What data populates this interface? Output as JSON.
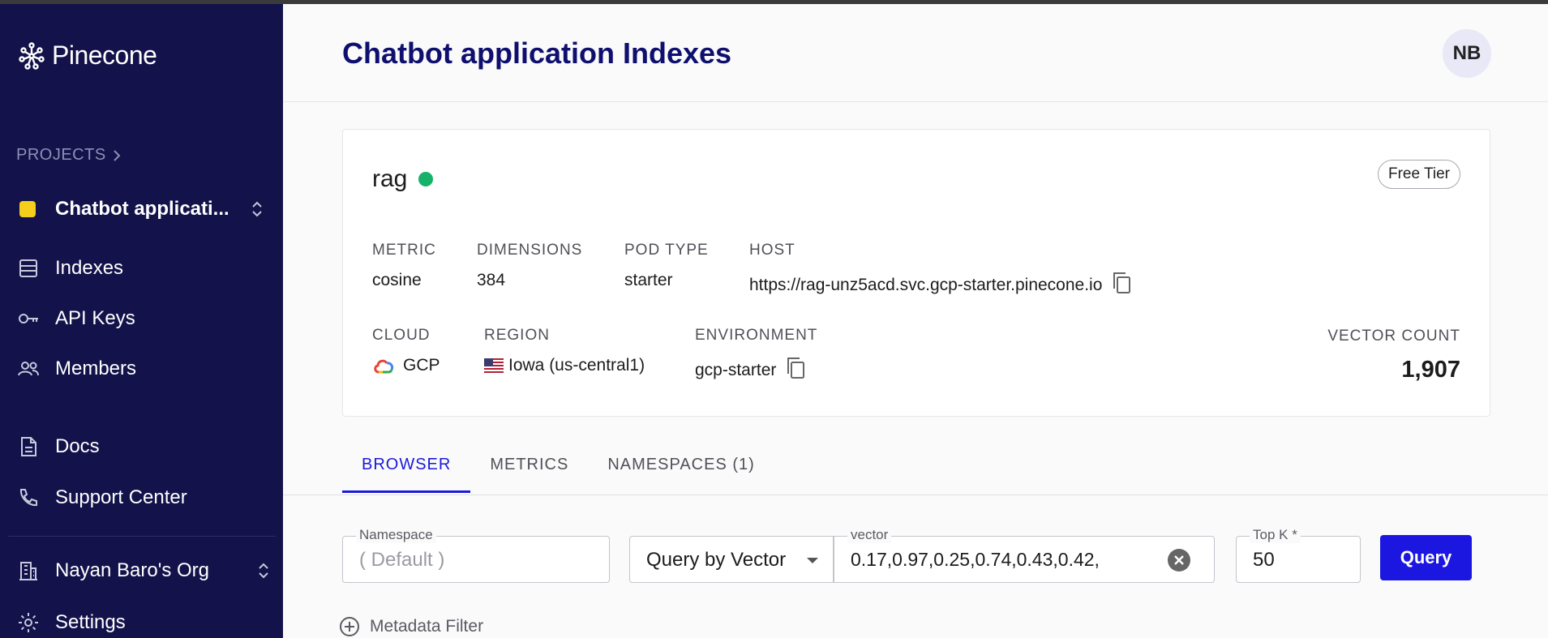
{
  "sidebar": {
    "logo_text": "Pinecone",
    "projects_label": "PROJECTS",
    "project_name": "Chatbot applicati...",
    "project_color": "#f5cf1b",
    "nav": {
      "indexes": "Indexes",
      "api_keys": "API Keys",
      "members": "Members",
      "docs": "Docs",
      "support": "Support Center",
      "org": "Nayan Baro's Org",
      "settings": "Settings"
    }
  },
  "header": {
    "title": "Chatbot application Indexes",
    "avatar_initials": "NB"
  },
  "index": {
    "name": "rag",
    "status_color": "#17b26a",
    "tier": "Free Tier",
    "metric_label": "METRIC",
    "metric": "cosine",
    "dimensions_label": "DIMENSIONS",
    "dimensions": "384",
    "pod_type_label": "POD TYPE",
    "pod_type": "starter",
    "host_label": "HOST",
    "host": "https://rag-unz5acd.svc.gcp-starter.pinecone.io",
    "cloud_label": "CLOUD",
    "cloud": "GCP",
    "region_label": "REGION",
    "region": "Iowa (us-central1)",
    "environment_label": "ENVIRONMENT",
    "environment": "gcp-starter",
    "vector_count_label": "VECTOR COUNT",
    "vector_count": "1,907"
  },
  "tabs": {
    "browser": "BROWSER",
    "metrics": "METRICS",
    "namespaces": "NAMESPACES (1)"
  },
  "query": {
    "namespace_label": "Namespace",
    "namespace_placeholder": "( Default )",
    "mode": "Query by Vector",
    "vector_label": "vector",
    "vector_value": "0.17,0.97,0.25,0.74,0.43,0.42,",
    "topk_label": "Top K *",
    "topk_value": "50",
    "query_button": "Query",
    "metadata_filter": "Metadata Filter"
  },
  "colors": {
    "sidebar_bg": "#13124a",
    "accent": "#1b17e1",
    "title": "#0e0f6e"
  }
}
